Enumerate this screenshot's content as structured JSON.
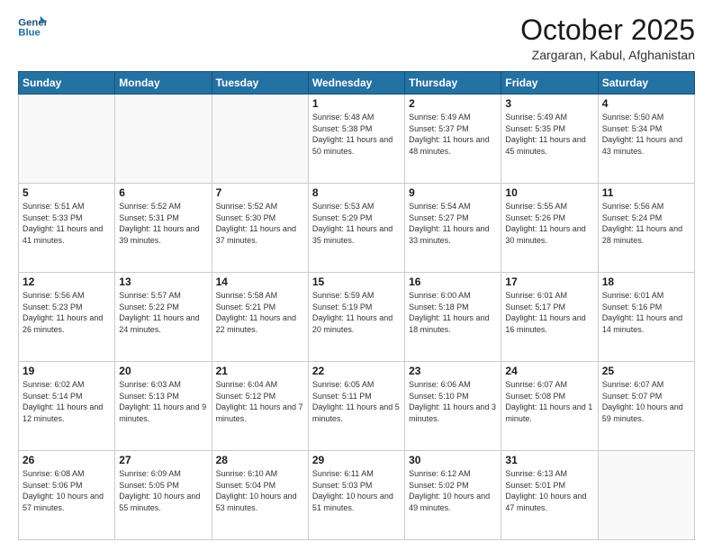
{
  "header": {
    "logo_line1": "General",
    "logo_line2": "Blue",
    "month": "October 2025",
    "location": "Zargaran, Kabul, Afghanistan"
  },
  "weekdays": [
    "Sunday",
    "Monday",
    "Tuesday",
    "Wednesday",
    "Thursday",
    "Friday",
    "Saturday"
  ],
  "weeks": [
    [
      {
        "day": "",
        "sunrise": "",
        "sunset": "",
        "daylight": ""
      },
      {
        "day": "",
        "sunrise": "",
        "sunset": "",
        "daylight": ""
      },
      {
        "day": "",
        "sunrise": "",
        "sunset": "",
        "daylight": ""
      },
      {
        "day": "1",
        "sunrise": "Sunrise: 5:48 AM",
        "sunset": "Sunset: 5:38 PM",
        "daylight": "Daylight: 11 hours and 50 minutes."
      },
      {
        "day": "2",
        "sunrise": "Sunrise: 5:49 AM",
        "sunset": "Sunset: 5:37 PM",
        "daylight": "Daylight: 11 hours and 48 minutes."
      },
      {
        "day": "3",
        "sunrise": "Sunrise: 5:49 AM",
        "sunset": "Sunset: 5:35 PM",
        "daylight": "Daylight: 11 hours and 45 minutes."
      },
      {
        "day": "4",
        "sunrise": "Sunrise: 5:50 AM",
        "sunset": "Sunset: 5:34 PM",
        "daylight": "Daylight: 11 hours and 43 minutes."
      }
    ],
    [
      {
        "day": "5",
        "sunrise": "Sunrise: 5:51 AM",
        "sunset": "Sunset: 5:33 PM",
        "daylight": "Daylight: 11 hours and 41 minutes."
      },
      {
        "day": "6",
        "sunrise": "Sunrise: 5:52 AM",
        "sunset": "Sunset: 5:31 PM",
        "daylight": "Daylight: 11 hours and 39 minutes."
      },
      {
        "day": "7",
        "sunrise": "Sunrise: 5:52 AM",
        "sunset": "Sunset: 5:30 PM",
        "daylight": "Daylight: 11 hours and 37 minutes."
      },
      {
        "day": "8",
        "sunrise": "Sunrise: 5:53 AM",
        "sunset": "Sunset: 5:29 PM",
        "daylight": "Daylight: 11 hours and 35 minutes."
      },
      {
        "day": "9",
        "sunrise": "Sunrise: 5:54 AM",
        "sunset": "Sunset: 5:27 PM",
        "daylight": "Daylight: 11 hours and 33 minutes."
      },
      {
        "day": "10",
        "sunrise": "Sunrise: 5:55 AM",
        "sunset": "Sunset: 5:26 PM",
        "daylight": "Daylight: 11 hours and 30 minutes."
      },
      {
        "day": "11",
        "sunrise": "Sunrise: 5:56 AM",
        "sunset": "Sunset: 5:24 PM",
        "daylight": "Daylight: 11 hours and 28 minutes."
      }
    ],
    [
      {
        "day": "12",
        "sunrise": "Sunrise: 5:56 AM",
        "sunset": "Sunset: 5:23 PM",
        "daylight": "Daylight: 11 hours and 26 minutes."
      },
      {
        "day": "13",
        "sunrise": "Sunrise: 5:57 AM",
        "sunset": "Sunset: 5:22 PM",
        "daylight": "Daylight: 11 hours and 24 minutes."
      },
      {
        "day": "14",
        "sunrise": "Sunrise: 5:58 AM",
        "sunset": "Sunset: 5:21 PM",
        "daylight": "Daylight: 11 hours and 22 minutes."
      },
      {
        "day": "15",
        "sunrise": "Sunrise: 5:59 AM",
        "sunset": "Sunset: 5:19 PM",
        "daylight": "Daylight: 11 hours and 20 minutes."
      },
      {
        "day": "16",
        "sunrise": "Sunrise: 6:00 AM",
        "sunset": "Sunset: 5:18 PM",
        "daylight": "Daylight: 11 hours and 18 minutes."
      },
      {
        "day": "17",
        "sunrise": "Sunrise: 6:01 AM",
        "sunset": "Sunset: 5:17 PM",
        "daylight": "Daylight: 11 hours and 16 minutes."
      },
      {
        "day": "18",
        "sunrise": "Sunrise: 6:01 AM",
        "sunset": "Sunset: 5:16 PM",
        "daylight": "Daylight: 11 hours and 14 minutes."
      }
    ],
    [
      {
        "day": "19",
        "sunrise": "Sunrise: 6:02 AM",
        "sunset": "Sunset: 5:14 PM",
        "daylight": "Daylight: 11 hours and 12 minutes."
      },
      {
        "day": "20",
        "sunrise": "Sunrise: 6:03 AM",
        "sunset": "Sunset: 5:13 PM",
        "daylight": "Daylight: 11 hours and 9 minutes."
      },
      {
        "day": "21",
        "sunrise": "Sunrise: 6:04 AM",
        "sunset": "Sunset: 5:12 PM",
        "daylight": "Daylight: 11 hours and 7 minutes."
      },
      {
        "day": "22",
        "sunrise": "Sunrise: 6:05 AM",
        "sunset": "Sunset: 5:11 PM",
        "daylight": "Daylight: 11 hours and 5 minutes."
      },
      {
        "day": "23",
        "sunrise": "Sunrise: 6:06 AM",
        "sunset": "Sunset: 5:10 PM",
        "daylight": "Daylight: 11 hours and 3 minutes."
      },
      {
        "day": "24",
        "sunrise": "Sunrise: 6:07 AM",
        "sunset": "Sunset: 5:08 PM",
        "daylight": "Daylight: 11 hours and 1 minute."
      },
      {
        "day": "25",
        "sunrise": "Sunrise: 6:07 AM",
        "sunset": "Sunset: 5:07 PM",
        "daylight": "Daylight: 10 hours and 59 minutes."
      }
    ],
    [
      {
        "day": "26",
        "sunrise": "Sunrise: 6:08 AM",
        "sunset": "Sunset: 5:06 PM",
        "daylight": "Daylight: 10 hours and 57 minutes."
      },
      {
        "day": "27",
        "sunrise": "Sunrise: 6:09 AM",
        "sunset": "Sunset: 5:05 PM",
        "daylight": "Daylight: 10 hours and 55 minutes."
      },
      {
        "day": "28",
        "sunrise": "Sunrise: 6:10 AM",
        "sunset": "Sunset: 5:04 PM",
        "daylight": "Daylight: 10 hours and 53 minutes."
      },
      {
        "day": "29",
        "sunrise": "Sunrise: 6:11 AM",
        "sunset": "Sunset: 5:03 PM",
        "daylight": "Daylight: 10 hours and 51 minutes."
      },
      {
        "day": "30",
        "sunrise": "Sunrise: 6:12 AM",
        "sunset": "Sunset: 5:02 PM",
        "daylight": "Daylight: 10 hours and 49 minutes."
      },
      {
        "day": "31",
        "sunrise": "Sunrise: 6:13 AM",
        "sunset": "Sunset: 5:01 PM",
        "daylight": "Daylight: 10 hours and 47 minutes."
      },
      {
        "day": "",
        "sunrise": "",
        "sunset": "",
        "daylight": ""
      }
    ]
  ]
}
